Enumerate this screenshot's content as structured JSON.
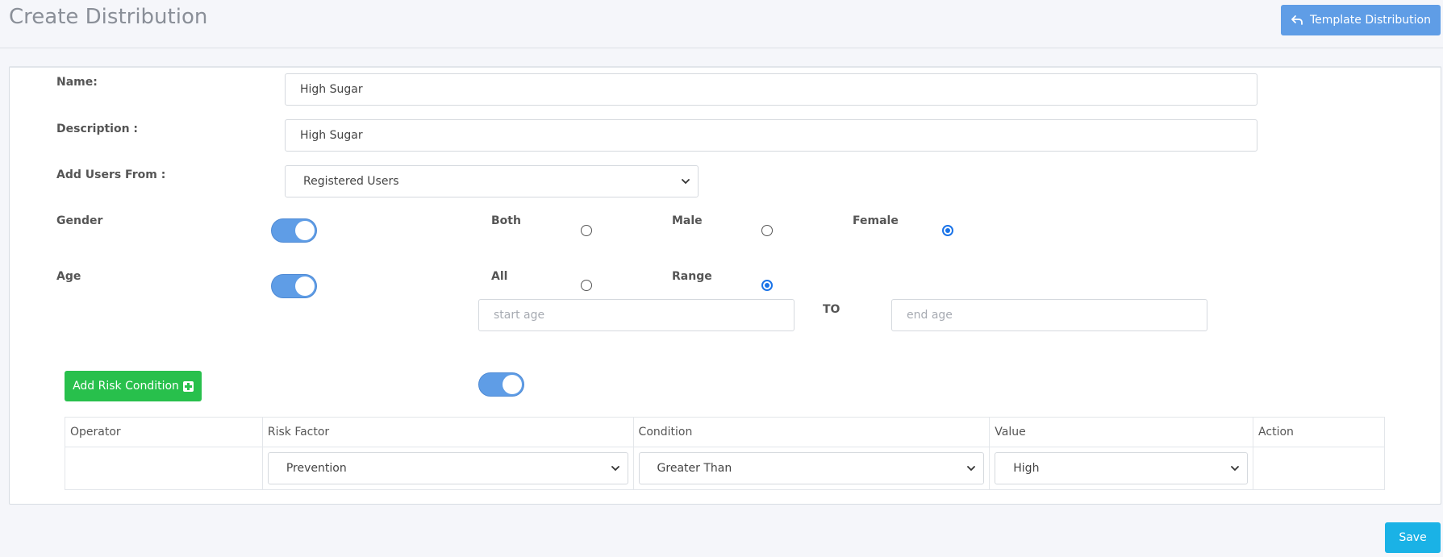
{
  "header": {
    "title": "Create Distribution",
    "template_button_label": "Template Distribution",
    "template_button_icon": "reply-arrow-icon"
  },
  "form": {
    "name": {
      "label": "Name:",
      "value": "High Sugar"
    },
    "description": {
      "label": "Description :",
      "value": "High Sugar"
    },
    "add_users_from": {
      "label": "Add Users From :",
      "selected": "Registered Users"
    },
    "gender": {
      "label": "Gender",
      "enabled": true,
      "options": [
        {
          "label": "Both",
          "checked": false
        },
        {
          "label": "Male",
          "checked": false
        },
        {
          "label": "Female",
          "checked": true
        }
      ]
    },
    "age": {
      "label": "Age",
      "enabled": true,
      "options": [
        {
          "label": "All",
          "checked": false
        },
        {
          "label": "Range",
          "checked": true
        }
      ],
      "start_placeholder": "start age",
      "to_label": "TO",
      "end_placeholder": "end age"
    },
    "risk": {
      "add_button_label": "Add Risk Condition",
      "enabled": true,
      "columns": [
        "Operator",
        "Risk Factor",
        "Condition",
        "Value",
        "Action"
      ],
      "rows": [
        {
          "operator": "",
          "risk_factor": "Prevention",
          "condition": "Greater Than",
          "value": "High",
          "action": ""
        }
      ]
    }
  },
  "footer": {
    "save_label": "Save"
  },
  "colors": {
    "primary": "#5f9de6",
    "success": "#28c04c",
    "info": "#1ab2e6",
    "radio_checked": "#1a73e8"
  }
}
